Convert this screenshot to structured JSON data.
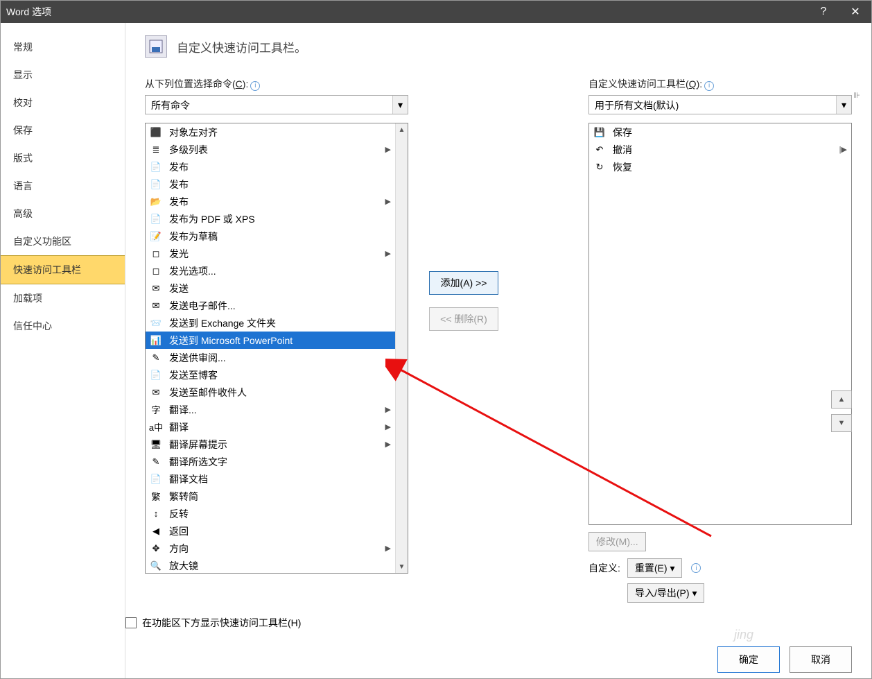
{
  "title": "Word 选项",
  "heading": "自定义快速访问工具栏。",
  "left_label_prefix": "从下列位置选择命令(",
  "left_label_accel": "C",
  "left_label_suffix": "):",
  "right_label_prefix": "自定义快速访问工具栏(",
  "right_label_accel": "Q",
  "right_label_suffix": "):",
  "combo_left": "所有命令",
  "combo_right": "用于所有文档(默认)",
  "nav": [
    "常规",
    "显示",
    "校对",
    "保存",
    "版式",
    "语言",
    "高级",
    "自定义功能区",
    "快速访问工具栏",
    "加载项",
    "信任中心"
  ],
  "nav_selected_index": 8,
  "left_items": [
    {
      "icon": "⬛",
      "label": "对象左对齐"
    },
    {
      "icon": "≣",
      "label": "多级列表",
      "arrow": true
    },
    {
      "icon": "📄",
      "label": "发布"
    },
    {
      "icon": "📄",
      "label": "发布"
    },
    {
      "icon": "📂",
      "label": "发布",
      "arrow": true
    },
    {
      "icon": "📄",
      "label": "发布为 PDF 或 XPS"
    },
    {
      "icon": "📝",
      "label": "发布为草稿"
    },
    {
      "icon": "◻",
      "label": "发光",
      "arrow": true
    },
    {
      "icon": "◻",
      "label": "发光选项..."
    },
    {
      "icon": "✉",
      "label": "发送"
    },
    {
      "icon": "✉",
      "label": "发送电子邮件..."
    },
    {
      "icon": "📨",
      "label": "发送到 Exchange 文件夹"
    },
    {
      "icon": "📊",
      "label": "发送到 Microsoft PowerPoint",
      "selected": true
    },
    {
      "icon": "✎",
      "label": "发送供审阅..."
    },
    {
      "icon": "📄",
      "label": "发送至博客"
    },
    {
      "icon": "✉",
      "label": "发送至邮件收件人"
    },
    {
      "icon": "字",
      "label": "翻译...",
      "arrow": true
    },
    {
      "icon": "a中",
      "label": "翻译",
      "arrow": true
    },
    {
      "icon": "🖥",
      "label": "翻译屏幕提示",
      "arrow": true
    },
    {
      "icon": "✎",
      "label": "翻译所选文字"
    },
    {
      "icon": "📄",
      "label": "翻译文档"
    },
    {
      "icon": "繁",
      "label": "繁转简"
    },
    {
      "icon": "↕",
      "label": "反转"
    },
    {
      "icon": "◀",
      "label": "返回"
    },
    {
      "icon": "✥",
      "label": "方向",
      "arrow": true
    },
    {
      "icon": "🔍",
      "label": "放大镜"
    }
  ],
  "right_items": [
    {
      "icon": "💾",
      "label": "保存"
    },
    {
      "icon": "↶",
      "label": "撤消",
      "arrow": true
    },
    {
      "icon": "↻",
      "label": "恢复"
    }
  ],
  "btn_add": "添加(A) >>",
  "btn_remove": "<< 删除(R)",
  "btn_modify": "修改(M)...",
  "label_customize": "自定义:",
  "btn_reset": "重置(E) ▾",
  "btn_import": "导入/导出(P) ▾",
  "chk_below": "在功能区下方显示快速访问工具栏(H)",
  "btn_ok": "确定",
  "btn_cancel": "取消",
  "watermark": "jing"
}
